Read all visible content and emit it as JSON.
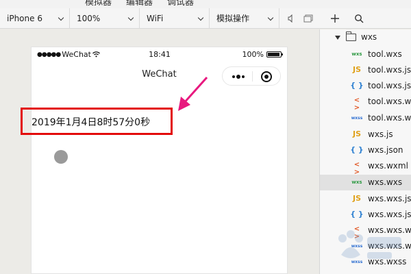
{
  "tabs": [
    "模拟器",
    "编辑器",
    "调试器"
  ],
  "toolbar": {
    "device": "iPhone 6",
    "zoom": "100%",
    "network": "WiFi",
    "action": "模拟操作"
  },
  "phone": {
    "status": {
      "carrier": "WeChat",
      "time": "18:41",
      "battery": "100%"
    },
    "nav_title": "WeChat",
    "time_text": "2019年1月4日8时57分0秒"
  },
  "file_tree": {
    "folder": "wxs",
    "files": [
      {
        "name": "tool.wxs",
        "icon": "wxs"
      },
      {
        "name": "tool.wxs.js",
        "icon": "JS"
      },
      {
        "name": "tool.wxs.json",
        "icon": "{ }"
      },
      {
        "name": "tool.wxs.wxml",
        "icon": "< >"
      },
      {
        "name": "tool.wxs.wxss",
        "icon": "wxss"
      },
      {
        "name": "wxs.js",
        "icon": "JS"
      },
      {
        "name": "wxs.json",
        "icon": "{ }"
      },
      {
        "name": "wxs.wxml",
        "icon": "< >"
      },
      {
        "name": "wxs.wxs",
        "icon": "wxs"
      },
      {
        "name": "wxs.wxs.js",
        "icon": "JS"
      },
      {
        "name": "wxs.wxs.json",
        "icon": "{ }"
      },
      {
        "name": "wxs.wxs.wxml",
        "icon": "< >"
      },
      {
        "name": "wxs.wxs.wxss",
        "icon": "wxss"
      },
      {
        "name": "wxs.wxss",
        "icon": "wxss"
      }
    ]
  },
  "colors": {
    "highlight_box": "#e30b0b",
    "arrow": "#e8197f"
  }
}
